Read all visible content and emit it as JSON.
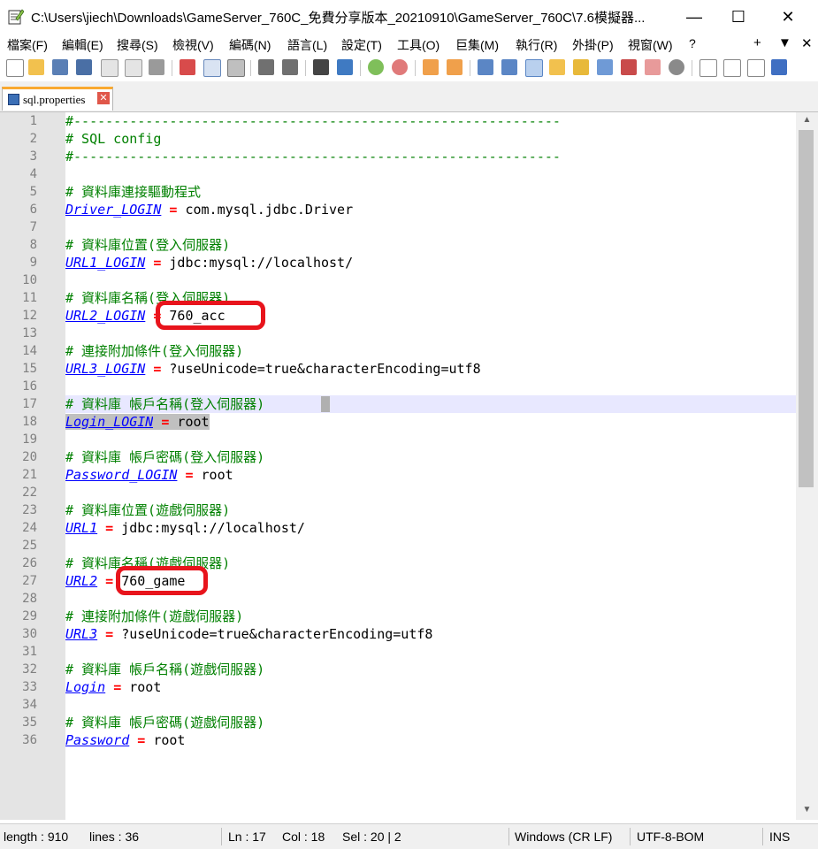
{
  "window": {
    "title": "C:\\Users\\jiech\\Downloads\\GameServer_760C_免費分享版本_20210910\\GameServer_760C\\7.6模擬器...",
    "min_glyph": "—",
    "max_glyph": "☐",
    "close_glyph": "✕"
  },
  "menu": [
    "檔案(F)",
    "編輯(E)",
    "搜尋(S)",
    "檢視(V)",
    "編碼(N)",
    "語言(L)",
    "設定(T)",
    "工具(O)",
    "巨集(M)",
    "執行(R)",
    "外掛(P)",
    "視窗(W)",
    "?"
  ],
  "menu_right": {
    "plus": "+",
    "down": "▼",
    "close": "✕"
  },
  "tab": {
    "label": "sql.properties",
    "close": "✕"
  },
  "editor": {
    "lines": [
      {
        "n": "1",
        "comment": "#-------------------------------------------------------------"
      },
      {
        "n": "2",
        "comment": "# SQL config"
      },
      {
        "n": "3",
        "comment": "#-------------------------------------------------------------"
      },
      {
        "n": "4"
      },
      {
        "n": "5",
        "comment": "# 資料庫連接驅動程式"
      },
      {
        "n": "6",
        "key": "Driver_LOGIN",
        "eq": "=",
        "val": " com.mysql.jdbc.Driver"
      },
      {
        "n": "7"
      },
      {
        "n": "8",
        "comment": "# 資料庫位置(登入伺服器)"
      },
      {
        "n": "9",
        "key": "URL1_LOGIN",
        "eq": "=",
        "val": " jdbc:mysql://localhost/"
      },
      {
        "n": "10"
      },
      {
        "n": "11",
        "comment": "# 資料庫名稱(登入伺服器)"
      },
      {
        "n": "12",
        "key": "URL2_LOGIN",
        "eq": "=",
        "val": " 760_acc"
      },
      {
        "n": "13"
      },
      {
        "n": "14",
        "comment": "# 連接附加條件(登入伺服器)"
      },
      {
        "n": "15",
        "key": "URL3_LOGIN",
        "eq": "=",
        "val": " ?useUnicode=true&characterEncoding=utf8"
      },
      {
        "n": "16"
      },
      {
        "n": "17",
        "comment": "# 資料庫 帳戶名稱(登入伺服器)"
      },
      {
        "n": "18",
        "key": "Login_LOGIN",
        "eq": "=",
        "val": " root"
      },
      {
        "n": "19"
      },
      {
        "n": "20",
        "comment": "# 資料庫 帳戶密碼(登入伺服器)"
      },
      {
        "n": "21",
        "key": "Password_LOGIN",
        "eq": "=",
        "val": " root"
      },
      {
        "n": "22"
      },
      {
        "n": "23",
        "comment": "# 資料庫位置(遊戲伺服器)"
      },
      {
        "n": "24",
        "key": "URL1",
        "eq": "=",
        "val": " jdbc:mysql://localhost/"
      },
      {
        "n": "25"
      },
      {
        "n": "26",
        "comment": "# 資料庫名稱(遊戲伺服器)"
      },
      {
        "n": "27",
        "key": "URL2",
        "eq": "=",
        "val": " 760_game"
      },
      {
        "n": "28"
      },
      {
        "n": "29",
        "comment": "# 連接附加條件(遊戲伺服器)"
      },
      {
        "n": "30",
        "key": "URL3",
        "eq": "=",
        "val": " ?useUnicode=true&characterEncoding=utf8"
      },
      {
        "n": "31"
      },
      {
        "n": "32",
        "comment": "# 資料庫 帳戶名稱(遊戲伺服器)"
      },
      {
        "n": "33",
        "key": "Login",
        "eq": "=",
        "val": " root"
      },
      {
        "n": "34"
      },
      {
        "n": "35",
        "comment": "# 資料庫 帳戶密碼(遊戲伺服器)"
      },
      {
        "n": "36",
        "key": "Password",
        "eq": "=",
        "val": " root"
      }
    ],
    "current_line": "17"
  },
  "status": {
    "length": "length : 910",
    "lines": "lines : 36",
    "ln": "Ln : 17",
    "col": "Col : 18",
    "sel": "Sel : 20 | 2",
    "eol": "Windows (CR LF)",
    "encoding": "UTF-8-BOM",
    "mode": "INS"
  },
  "colors": {
    "comment": "#008000",
    "key": "#0000ff",
    "operator": "#ff0000",
    "annotation_box": "#e8141c",
    "tab_accent": "#f9a930"
  }
}
